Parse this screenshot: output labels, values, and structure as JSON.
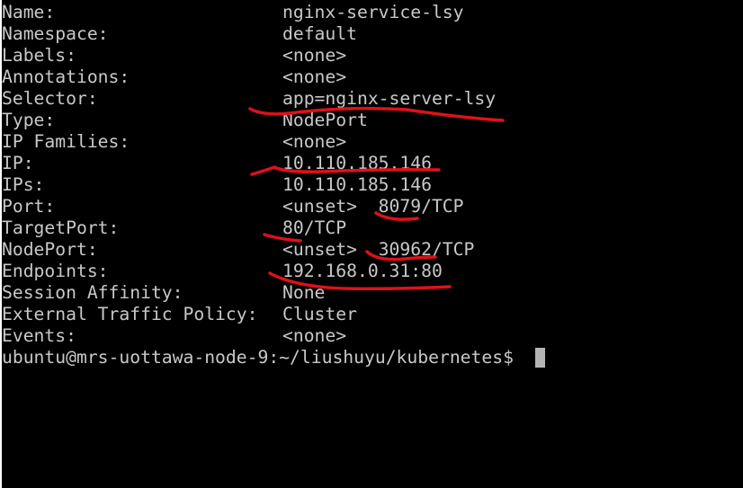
{
  "terminal": {
    "rows": [
      {
        "key": "Name:",
        "value": "nginx-service-lsy"
      },
      {
        "key": "Namespace:",
        "value": "default"
      },
      {
        "key": "Labels:",
        "value": "<none>"
      },
      {
        "key": "Annotations:",
        "value": "<none>"
      },
      {
        "key": "Selector:",
        "value": "app=nginx-server-lsy"
      },
      {
        "key": "Type:",
        "value": "NodePort"
      },
      {
        "key": "IP Families:",
        "value": "<none>"
      },
      {
        "key": "IP:",
        "value": "10.110.185.146"
      },
      {
        "key": "IPs:",
        "value": "10.110.185.146"
      },
      {
        "key": "Port:",
        "value": "<unset>  8079/TCP"
      },
      {
        "key": "TargetPort:",
        "value": "80/TCP"
      },
      {
        "key": "NodePort:",
        "value": "<unset>  30962/TCP"
      },
      {
        "key": "Endpoints:",
        "value": "192.168.0.31:80"
      },
      {
        "key": "Session Affinity:",
        "value": "None"
      },
      {
        "key": "External Traffic Policy:",
        "value": "Cluster"
      },
      {
        "key": "Events:",
        "value": "<none>"
      }
    ],
    "prompt": "ubuntu@mrs-uottawa-node-9:~/liushuyu/kubernetes$ ",
    "text_color": "#c8c8c8",
    "background_color": "#000000",
    "annotation_color": "#e0101a"
  }
}
